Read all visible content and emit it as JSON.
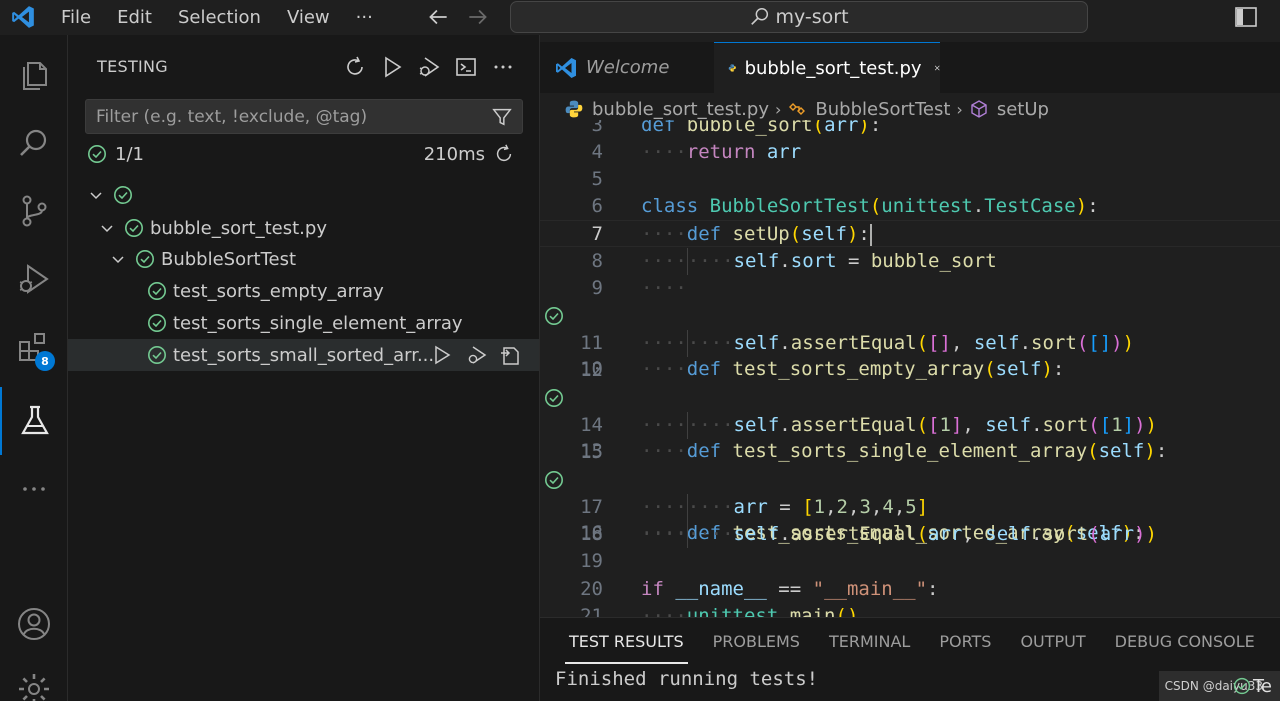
{
  "titlebar": {
    "menu": [
      "File",
      "Edit",
      "Selection",
      "View",
      "···"
    ],
    "search": "my-sort"
  },
  "activity": {
    "extensions_badge": "8"
  },
  "sidebar": {
    "title": "TESTING",
    "filter_placeholder": "Filter (e.g. text, !exclude, @tag)",
    "summary_count": "1/1",
    "summary_time": "210ms",
    "tree": [
      {
        "label": "",
        "level": 0
      },
      {
        "label": "bubble_sort_test.py",
        "level": 1
      },
      {
        "label": "BubbleSortTest",
        "level": 2
      },
      {
        "label": "test_sorts_empty_array",
        "level": 3
      },
      {
        "label": "test_sorts_single_element_array",
        "level": 3
      },
      {
        "label": "test_sorts_small_sorted_arr...",
        "level": 3
      }
    ]
  },
  "editor": {
    "tabs": [
      {
        "label": "Welcome"
      },
      {
        "label": "bubble_sort_test.py"
      }
    ],
    "breadcrumb": [
      "bubble_sort_test.py",
      "BubbleSortTest",
      "setUp"
    ],
    "line_numbers": [
      "3",
      "4",
      "5",
      "6",
      "7",
      "8",
      "9",
      "10",
      "11",
      "12",
      "13",
      "14",
      "15",
      "16",
      "17",
      "18",
      "19",
      "20",
      "21"
    ],
    "current_line": "7",
    "passed_lines": [
      "10",
      "13",
      "16"
    ]
  },
  "panel": {
    "tabs": [
      "TEST RESULTS",
      "PROBLEMS",
      "TERMINAL",
      "PORTS",
      "OUTPUT",
      "DEBUG CONSOLE"
    ],
    "output": "Finished running tests!",
    "watermark": "CSDN @daiyu33",
    "watermark_tail": "Te"
  },
  "colors": {
    "accent": "#0078d4",
    "pass": "#73c991"
  }
}
